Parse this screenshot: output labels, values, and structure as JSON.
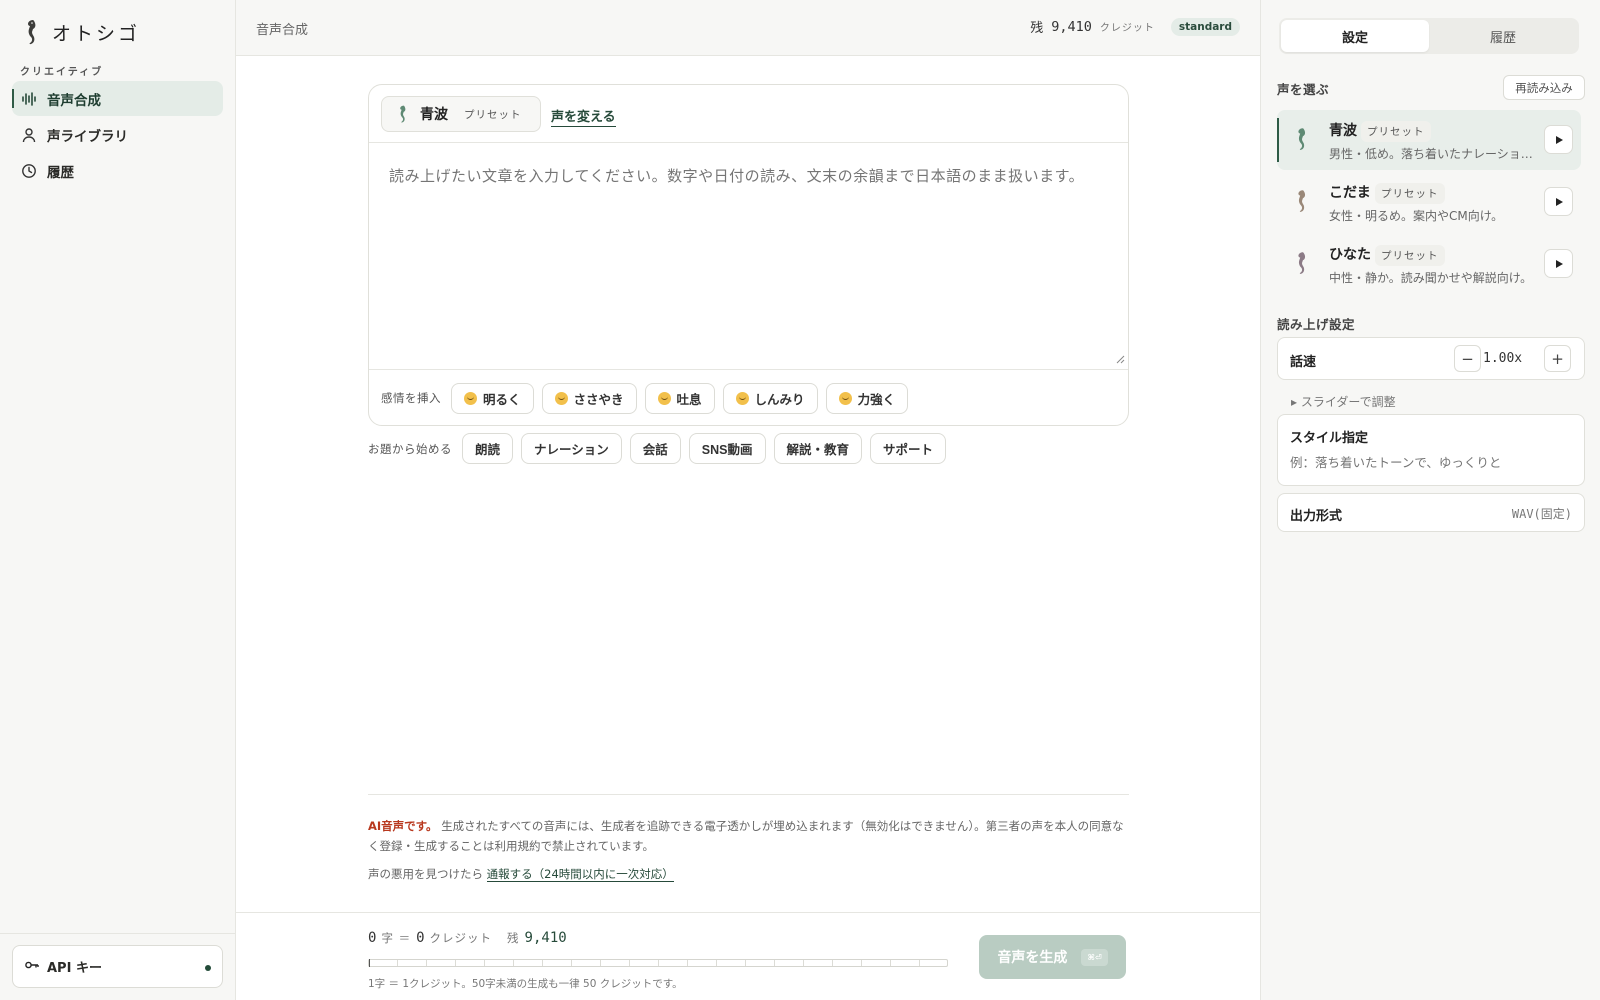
{
  "app": {
    "name": "オトシゴ",
    "section_label": "クリエイティブ"
  },
  "nav": [
    {
      "label": "音声合成",
      "icon": "waveform-icon",
      "active": true
    },
    {
      "label": "声ライブラリ",
      "icon": "person-icon",
      "active": false
    },
    {
      "label": "履歴",
      "icon": "clock-icon",
      "active": false
    }
  ],
  "api": {
    "label": "API キー",
    "icon": "key-icon",
    "status": "connected"
  },
  "header": {
    "crumb": "音声合成",
    "credits_label": "残",
    "credits_value": "9,410",
    "credits_unit": "クレジット",
    "plan": "standard"
  },
  "editor": {
    "voice_name": "青波",
    "voice_tag": "プリセット",
    "change_voice": "声を変える",
    "placeholder": "読み上げたい文章を入力してください。数字や日付の読み、文末の余韻まで日本語のまま扱います。",
    "emotion_label": "感情を挿入",
    "emotions": [
      "明るく",
      "ささやき",
      "吐息",
      "しんみり",
      "力強く"
    ]
  },
  "topics": {
    "label": "お題から始める",
    "items": [
      "朗読",
      "ナレーション",
      "会話",
      "SNS動画",
      "解説・教育",
      "サポート"
    ]
  },
  "disclaimer": {
    "ai_label": "AI音声です。",
    "text": "生成されたすべての音声には、生成者を追跡できる電子透かしが埋め込まれます（無効化はできません）。第三者の声を本人の同意なく登録・生成することは利用規約で禁止されています。",
    "report_prefix": "声の悪用を見つけたら",
    "report_link": "通報する（24時間以内に一次対応）"
  },
  "footer": {
    "chars": "0",
    "chars_unit": "字 ＝",
    "credits": "0",
    "credits_unit": "クレジット",
    "remaining_label": "残",
    "remaining_value": "9,410",
    "usage_fraction": 0,
    "note": "1字 ＝ 1クレジット。50字未満の生成も一律 50 クレジットです。",
    "generate_label": "音声を生成",
    "shortcut": "⌘⏎"
  },
  "right_panel": {
    "tabs": [
      "設定",
      "履歴"
    ],
    "voice_section": "声を選ぶ",
    "reload": "再読み込み",
    "voices": [
      {
        "name": "青波",
        "tag": "プリセット",
        "desc": "男性・低め。落ち着いたナレーション向け。",
        "active": true,
        "color": "#5f8a74"
      },
      {
        "name": "こだま",
        "tag": "プリセット",
        "desc": "女性・明るめ。案内やCM向け。",
        "active": false,
        "color": "#9a8878"
      },
      {
        "name": "ひなた",
        "tag": "プリセット",
        "desc": "中性・静か。読み聞かせや解説向け。",
        "active": false,
        "color": "#8c7b86"
      }
    ],
    "read_section": "読み上げ設定",
    "speed_label": "話速",
    "speed_value": "1.00x",
    "slider_hint": "▸ スライダーで調整",
    "style_label": "スタイル指定",
    "style_placeholder": "例：落ち着いたトーンで、ゆっくりと",
    "output_label": "出力形式",
    "output_value": "WAV(固定)"
  },
  "colors": {
    "accent": "#264a3a",
    "accent_soft": "#e4ece7",
    "warning": "#b8381e",
    "button_disabled": "#b9ccc2"
  }
}
